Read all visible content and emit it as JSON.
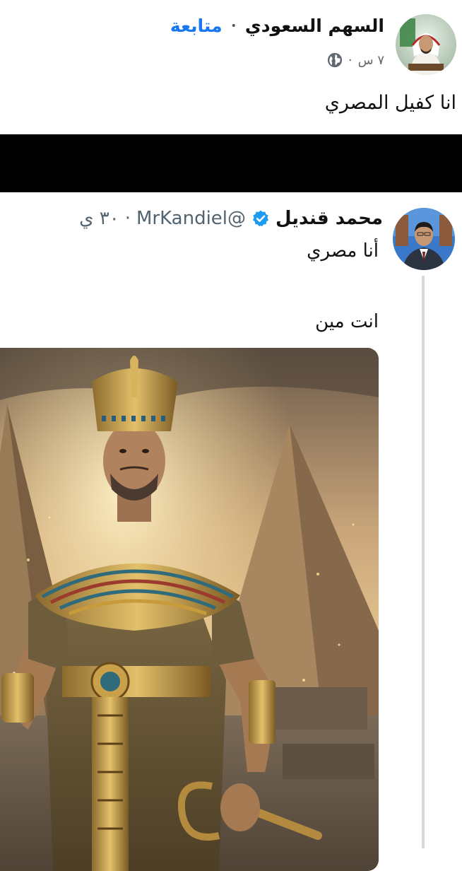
{
  "fb_post": {
    "page_name": "السهم السعودي",
    "separator": "•",
    "follow_label": "متابعة",
    "time": "٧ س",
    "meta_separator": "·",
    "privacy_icon": "globe-icon",
    "text": "انا كفيل المصري"
  },
  "tweet": {
    "name": "محمد قنديل",
    "verified_icon": "verified-badge-icon",
    "handle": "@MrKandiel",
    "separator": "·",
    "time": "٣٠ ي",
    "line1": "أنا مصري",
    "line2": "انت مين"
  },
  "colors": {
    "follow_blue": "#1877f2",
    "verified_blue": "#1d9bf0",
    "muted_gray": "#536471"
  }
}
